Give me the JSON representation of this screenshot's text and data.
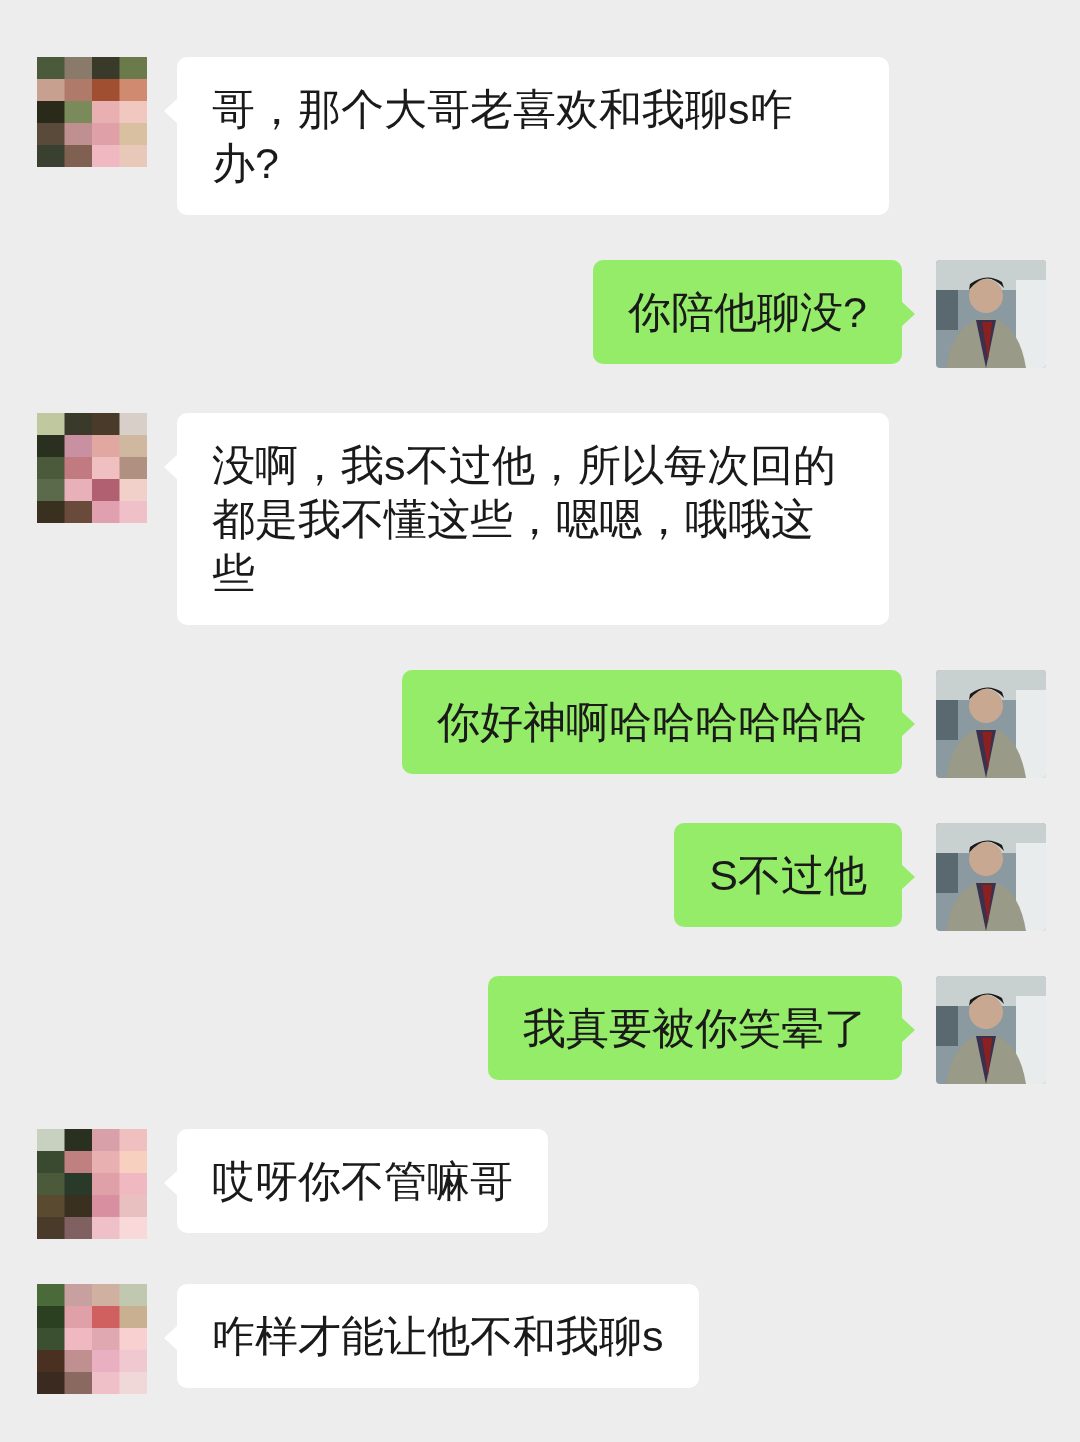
{
  "messages": [
    {
      "kind": "incoming",
      "text": "哥，那个大哥老喜欢和我聊s咋办?"
    },
    {
      "kind": "outgoing",
      "text": "你陪他聊没?"
    },
    {
      "kind": "incoming",
      "text": "没啊，我s不过他，所以每次回的都是我不懂这些，嗯嗯，哦哦这些"
    },
    {
      "kind": "outgoing",
      "text": "你好神啊哈哈哈哈哈哈"
    },
    {
      "kind": "outgoing",
      "text": "S不过他"
    },
    {
      "kind": "outgoing",
      "text": "我真要被你笑晕了"
    },
    {
      "kind": "incoming",
      "text": "哎呀你不管嘛哥"
    },
    {
      "kind": "incoming",
      "text": "咋样才能让他不和我聊s"
    }
  ]
}
